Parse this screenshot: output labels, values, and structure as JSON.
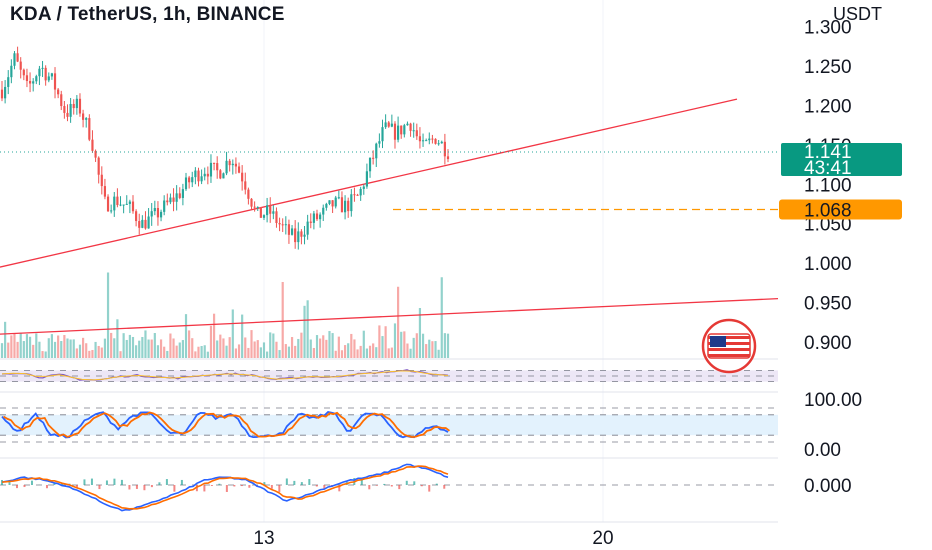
{
  "header": {
    "title": "KDA / TetherUS, 1h, BINANCE",
    "currency": "USDT"
  },
  "colors": {
    "up": "#26a69a",
    "down": "#ef5350",
    "trend": "#f23645",
    "orange": "#ff9800",
    "teal_badge": "#089981",
    "stoch_k": "#2962ff",
    "stoch_d": "#ff6d00",
    "macd": "#2962ff",
    "signal": "#ff6d00",
    "rsi_band": "#ede7f6",
    "stoch_band": "#e3f2fd"
  },
  "chart_data": [
    {
      "type": "candlestick",
      "name": "price",
      "y_ticks": [
        "1.300",
        "1.250",
        "1.200",
        "1.150",
        "1.100",
        "1.050",
        "1.000",
        "0.950",
        "0.900"
      ],
      "ylim": [
        0.88,
        1.32
      ],
      "x_ticks": [
        "13",
        "20"
      ],
      "last_price": {
        "value": "1.141",
        "countdown": "43:41"
      },
      "horizontal_level": {
        "value": "1.068",
        "style": "dashed",
        "color": "orange"
      },
      "trendlines": [
        {
          "from_price": 0.995,
          "to_price": 1.208
        },
        {
          "from_price": 0.91,
          "to_price": 0.955
        }
      ],
      "path_anchors": [
        1.22,
        1.26,
        1.22,
        1.25,
        1.23,
        1.19,
        1.2,
        1.16,
        1.075,
        1.08,
        1.07,
        1.05,
        1.06,
        1.075,
        1.09,
        1.11,
        1.12,
        1.115,
        1.135,
        1.105,
        1.06,
        1.065,
        1.045,
        1.03,
        1.05,
        1.06,
        1.075,
        1.072,
        1.085,
        1.13,
        1.17,
        1.165,
        1.18,
        1.145,
        1.16,
        1.142
      ],
      "candle_count": 144,
      "volume": {
        "bars": 144,
        "spikes": [
          0.9,
          0.8,
          0.75,
          0.85
        ]
      }
    },
    {
      "type": "line",
      "name": "rsi",
      "bands": [
        30,
        70
      ],
      "anchors": [
        58,
        62,
        45,
        55,
        38,
        35,
        48,
        52,
        46,
        42,
        50,
        55,
        58,
        52,
        38,
        42,
        48,
        45,
        55,
        60,
        65,
        70,
        58,
        52
      ]
    },
    {
      "type": "line",
      "name": "stochastic",
      "y_ticks": [
        "100.00",
        "0.00"
      ],
      "bands": [
        20,
        80
      ],
      "anchors": [
        70,
        30,
        85,
        20,
        15,
        60,
        90,
        40,
        80,
        85,
        30,
        20,
        90,
        70,
        85,
        20,
        15,
        30,
        80,
        70,
        90,
        30,
        85,
        75,
        20,
        15,
        50,
        30
      ]
    },
    {
      "type": "line",
      "name": "macd",
      "y_ticks": [
        "0.000"
      ],
      "anchors": [
        0.002,
        0.006,
        0.004,
        0.0,
        -0.006,
        -0.014,
        -0.02,
        -0.016,
        -0.01,
        -0.004,
        0.004,
        0.006,
        0.004,
        -0.004,
        -0.012,
        -0.008,
        -0.002,
        0.003,
        0.006,
        0.01,
        0.016,
        0.012,
        0.006
      ]
    }
  ]
}
